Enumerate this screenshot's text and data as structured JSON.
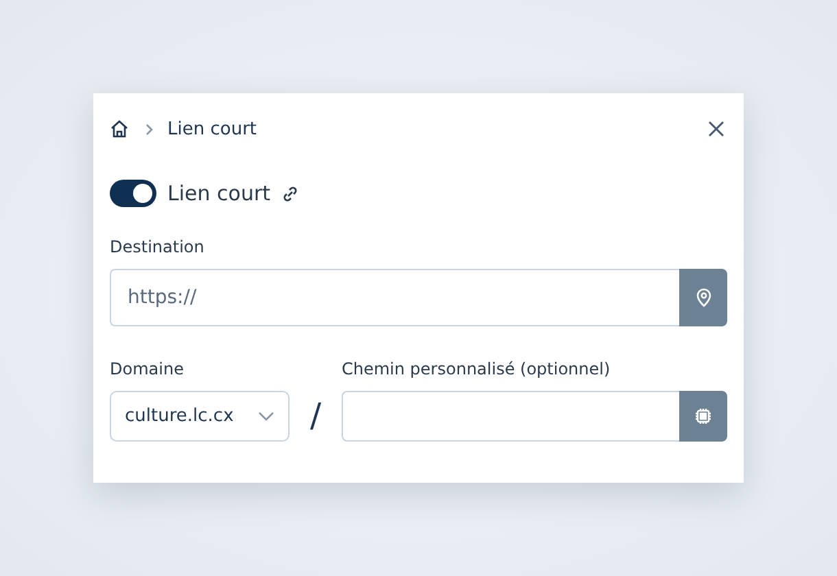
{
  "breadcrumb": {
    "current": "Lien court"
  },
  "toggle": {
    "label": "Lien court",
    "on": true
  },
  "destination": {
    "label": "Destination",
    "placeholder": "https://"
  },
  "domain": {
    "label": "Domaine",
    "value": "culture.lc.cx"
  },
  "separator": "/",
  "path": {
    "label": "Chemin personnalisé (optionnel)"
  }
}
